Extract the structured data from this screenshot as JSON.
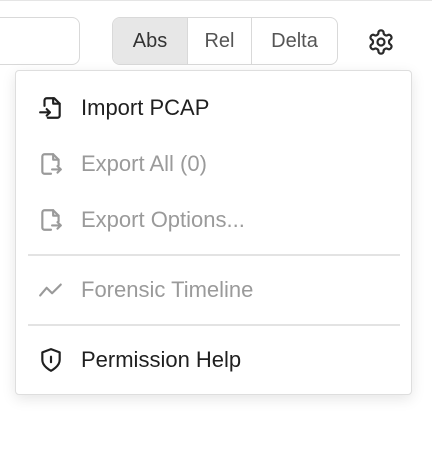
{
  "colors": {
    "text_enabled": "#1f1f1f",
    "text_disabled": "#9a9a9a",
    "active_segment_bg": "#e7e7e7",
    "border": "#d9d9d9"
  },
  "toolbar": {
    "filter_input": {
      "value": "",
      "placeholder": ""
    },
    "time_modes": [
      {
        "label": "Abs",
        "selected": true
      },
      {
        "label": "Rel",
        "selected": false
      },
      {
        "label": "Delta",
        "selected": false
      }
    ],
    "settings_icon": "gear-icon"
  },
  "menu": {
    "items": [
      {
        "label": "Import PCAP",
        "icon": "file-import-icon",
        "enabled": true
      },
      {
        "label": "Export All (0)",
        "icon": "file-export-icon",
        "enabled": false
      },
      {
        "label": "Export Options...",
        "icon": "file-export-icon",
        "enabled": false
      },
      {
        "label": "Forensic Timeline",
        "icon": "line-chart-icon",
        "enabled": false
      },
      {
        "label": "Permission Help",
        "icon": "shield-icon",
        "enabled": true
      }
    ]
  }
}
